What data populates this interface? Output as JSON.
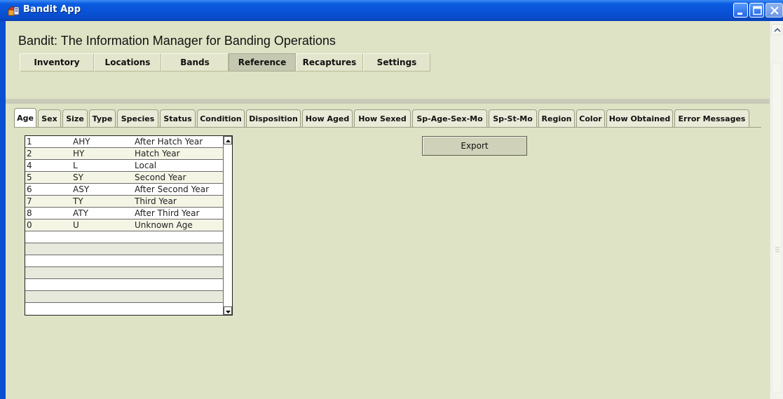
{
  "window": {
    "title": "Bandit App",
    "icon": "bandit-app-icon"
  },
  "header": {
    "heading": "Bandit: The Information Manager for Banding Operations"
  },
  "nav": {
    "items": [
      {
        "label": "Inventory",
        "active": false
      },
      {
        "label": "Locations",
        "active": false
      },
      {
        "label": "Bands",
        "active": false
      },
      {
        "label": "Reference",
        "active": true
      },
      {
        "label": "Recaptures",
        "active": false
      },
      {
        "label": "Settings",
        "active": false
      }
    ]
  },
  "tabs": {
    "items": [
      {
        "label": "Age",
        "active": true
      },
      {
        "label": "Sex"
      },
      {
        "label": "Size"
      },
      {
        "label": "Type"
      },
      {
        "label": "Species"
      },
      {
        "label": "Status"
      },
      {
        "label": "Condition"
      },
      {
        "label": "Disposition"
      },
      {
        "label": "How Aged"
      },
      {
        "label": "How Sexed"
      },
      {
        "label": "Sp-Age-Sex-Mo"
      },
      {
        "label": "Sp-St-Mo"
      },
      {
        "label": "Region"
      },
      {
        "label": "Color"
      },
      {
        "label": "How Obtained"
      },
      {
        "label": "Error Messages"
      }
    ]
  },
  "age_list": {
    "rows": [
      {
        "id": "1",
        "code": "AHY",
        "description": "After Hatch Year"
      },
      {
        "id": "2",
        "code": "HY",
        "description": "Hatch Year"
      },
      {
        "id": "4",
        "code": "L",
        "description": "Local"
      },
      {
        "id": "5",
        "code": "SY",
        "description": "Second Year"
      },
      {
        "id": "6",
        "code": "ASY",
        "description": "After Second Year"
      },
      {
        "id": "7",
        "code": "TY",
        "description": "Third Year"
      },
      {
        "id": "8",
        "code": "ATY",
        "description": "After Third Year"
      },
      {
        "id": "0",
        "code": "U",
        "description": "Unknown Age"
      }
    ]
  },
  "actions": {
    "export_label": "Export"
  },
  "colors": {
    "titlebar": "#0a52d6",
    "panel": "#dfe3c5",
    "active_nav": "#c5c8b0"
  }
}
